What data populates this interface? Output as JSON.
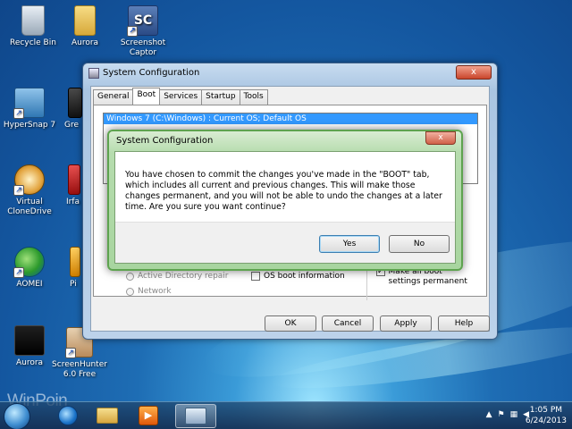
{
  "desktop_icons": [
    {
      "label": "Recycle Bin"
    },
    {
      "label": "Aurora"
    },
    {
      "label": "Screenshot Captor"
    },
    {
      "label": "HyperSnap 7"
    },
    {
      "label": "Gre"
    },
    {
      "label": "Virtual CloneDrive"
    },
    {
      "label": "Irfa"
    },
    {
      "label": "AOMEI"
    },
    {
      "label": "Pi"
    },
    {
      "label": "Aurora"
    },
    {
      "label": "ScreenHunter 6.0 Free"
    }
  ],
  "screenshot_captor_badge": "SC",
  "syscfg": {
    "title": "System Configuration",
    "close_glyph": "x",
    "tabs": [
      "General",
      "Boot",
      "Services",
      "Startup",
      "Tools"
    ],
    "os_entry": "Windows 7 (C:\\Windows) : Current OS; Default OS",
    "options": {
      "active_directory_repair": "Active Directory repair",
      "network": "Network",
      "os_boot_information": "OS boot information",
      "make_permanent": "Make all boot settings permanent",
      "make_permanent_checked": true
    },
    "buttons": {
      "ok": "OK",
      "cancel": "Cancel",
      "apply": "Apply",
      "help": "Help"
    }
  },
  "dialog": {
    "title": "System Configuration",
    "close_glyph": "x",
    "message": "You have chosen to commit the changes you've made in the \"BOOT\" tab, which includes all current and previous changes. This will make those changes permanent, and you will not be able to undo the changes at a later time. Are you sure you want continue?",
    "yes": "Yes",
    "no": "No"
  },
  "taskbar": {
    "time": "1:05 PM",
    "date": "6/24/2013"
  },
  "watermark": "WinPoin",
  "colors": {
    "dialog_frame": "#5ea34f",
    "selection": "#3399ff"
  }
}
